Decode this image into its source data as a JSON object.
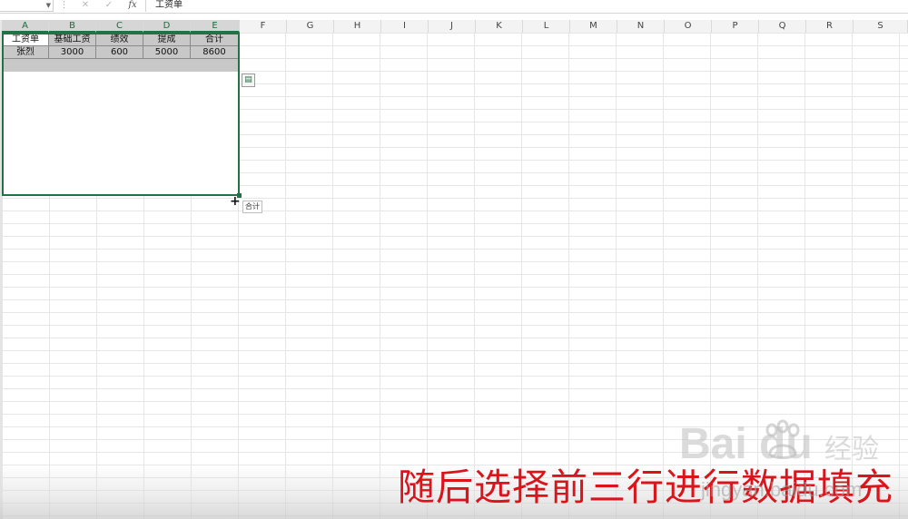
{
  "formula_bar": {
    "cancel_icon": "✕",
    "enter_icon": "✓",
    "fx_label": "fx",
    "value": "工资单"
  },
  "columns": [
    "A",
    "B",
    "C",
    "D",
    "E",
    "F",
    "G",
    "H",
    "I",
    "J",
    "K",
    "L",
    "M",
    "N",
    "O",
    "P",
    "Q",
    "R",
    "S"
  ],
  "sheet": {
    "header_row": [
      "工资单",
      "基础工资",
      "绩效",
      "提成",
      "合计"
    ],
    "data_row": [
      "张烈",
      "3000",
      "600",
      "5000",
      "8600"
    ]
  },
  "fill_tooltip": "合计",
  "caption": "随后选择前三行进行数据填充",
  "watermark": {
    "brand": "Bai  du",
    "brand_cn": "经验",
    "url": "jingyan.baidu.com"
  },
  "colors": {
    "selection": "#217346",
    "caption": "#d9141b"
  }
}
